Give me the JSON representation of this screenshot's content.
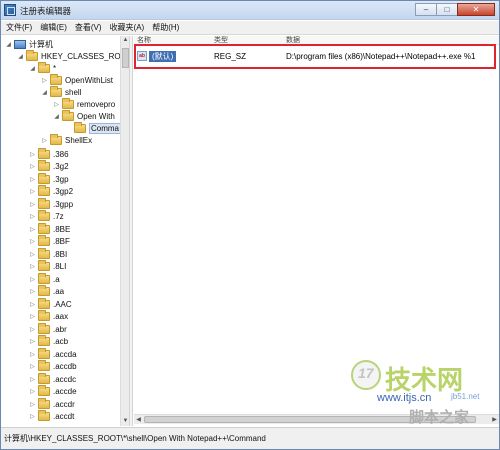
{
  "window": {
    "title": "注册表编辑器",
    "buttons": {
      "minimize": "–",
      "maximize": "□",
      "close": "✕"
    }
  },
  "menu": [
    "文件(F)",
    "编辑(E)",
    "查看(V)",
    "收藏夹(A)",
    "帮助(H)"
  ],
  "tree": {
    "items": [
      {
        "label": "计算机",
        "icon": "computer-icon",
        "expander": "◢"
      },
      {
        "label": "HKEY_CLASSES_ROOT",
        "icon": "folder-icon",
        "expander": "◢"
      },
      {
        "label": "*",
        "icon": "folder-icon",
        "expander": "◢"
      },
      {
        "label": "OpenWithList",
        "icon": "folder-icon",
        "expander": "▷"
      },
      {
        "label": "shell",
        "icon": "folder-icon",
        "expander": "◢"
      },
      {
        "label": "removepro",
        "icon": "folder-icon",
        "expander": "▷"
      },
      {
        "label": "Open With",
        "icon": "folder-icon",
        "expander": "◢"
      },
      {
        "label": "Comma",
        "icon": "folder-icon",
        "expander": ""
      },
      {
        "label": "ShellEx",
        "icon": "folder-icon",
        "expander": "▷"
      },
      {
        "label": ".386",
        "icon": "folder-icon",
        "expander": "▷"
      },
      {
        "label": ".3g2",
        "icon": "folder-icon",
        "expander": "▷"
      },
      {
        "label": ".3gp",
        "icon": "folder-icon",
        "expander": "▷"
      },
      {
        "label": ".3gp2",
        "icon": "folder-icon",
        "expander": "▷"
      },
      {
        "label": ".3gpp",
        "icon": "folder-icon",
        "expander": "▷"
      },
      {
        "label": ".7z",
        "icon": "folder-icon",
        "expander": "▷"
      },
      {
        "label": ".8BE",
        "icon": "folder-icon",
        "expander": "▷"
      },
      {
        "label": ".8BF",
        "icon": "folder-icon",
        "expander": "▷"
      },
      {
        "label": ".8BI",
        "icon": "folder-icon",
        "expander": "▷"
      },
      {
        "label": ".8LI",
        "icon": "folder-icon",
        "expander": "▷"
      },
      {
        "label": ".a",
        "icon": "folder-icon",
        "expander": "▷"
      },
      {
        "label": ".aa",
        "icon": "folder-icon",
        "expander": "▷"
      },
      {
        "label": ".AAC",
        "icon": "folder-icon",
        "expander": "▷"
      },
      {
        "label": ".aax",
        "icon": "folder-icon",
        "expander": "▷"
      },
      {
        "label": ".abr",
        "icon": "folder-icon",
        "expander": "▷"
      },
      {
        "label": ".acb",
        "icon": "folder-icon",
        "expander": "▷"
      },
      {
        "label": ".accda",
        "icon": "folder-icon",
        "expander": "▷"
      },
      {
        "label": ".accdb",
        "icon": "folder-icon",
        "expander": "▷"
      },
      {
        "label": ".accdc",
        "icon": "folder-icon",
        "expander": "▷"
      },
      {
        "label": ".accde",
        "icon": "folder-icon",
        "expander": "▷"
      },
      {
        "label": ".accdr",
        "icon": "folder-icon",
        "expander": "▷"
      },
      {
        "label": ".accdt",
        "icon": "folder-icon",
        "expander": "▷"
      }
    ]
  },
  "list": {
    "columns": [
      "名称",
      "类型",
      "数据"
    ],
    "rows": [
      {
        "icon_text": "ab",
        "name": "(默认)",
        "type": "REG_SZ",
        "data": "D:\\program files (x86)\\Notepad++\\Notepad++.exe %1"
      }
    ]
  },
  "status": {
    "path": "计算机\\HKEY_CLASSES_ROOT\\*\\shell\\Open With Notepad++\\Command"
  },
  "watermark": {
    "number": "17",
    "chinese": "技术网",
    "url": "www.itjs.cn",
    "url2": "jb51.net",
    "bottom": "脚本之家"
  },
  "colors": {
    "highlight_border": "#e0232f",
    "selection_bg": "#3e6fb3"
  }
}
